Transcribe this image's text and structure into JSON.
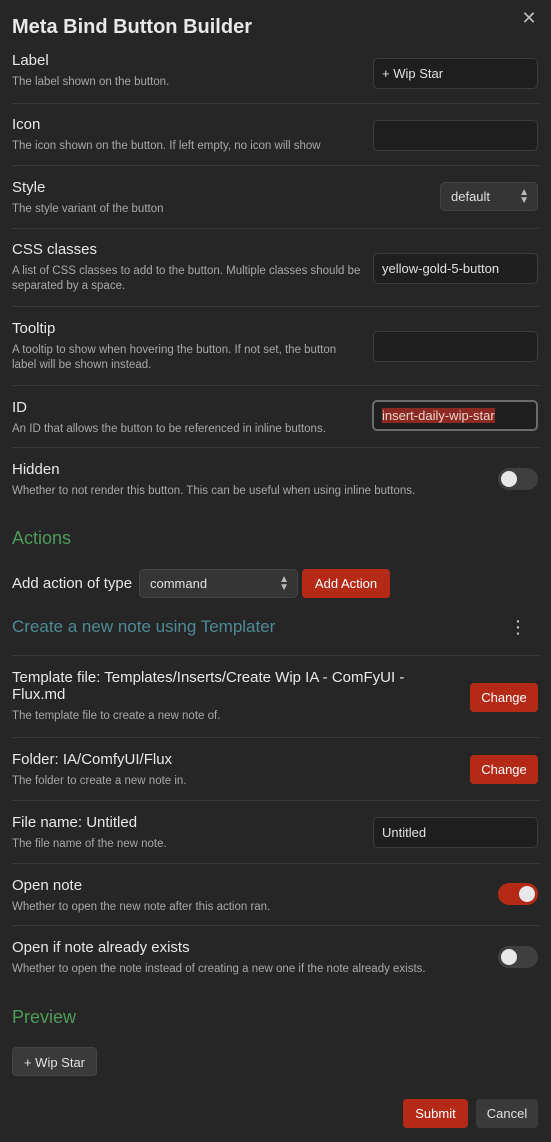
{
  "window": {
    "title": "Meta Bind Button Builder",
    "close_icon": "close-icon"
  },
  "fields": {
    "label": {
      "name": "Label",
      "desc": "The label shown on the button.",
      "value": "+ Wip Star"
    },
    "icon": {
      "name": "Icon",
      "desc": "The icon shown on the button. If left empty, no icon will show",
      "value": ""
    },
    "style": {
      "name": "Style",
      "desc": "The style variant of the button",
      "value": "default"
    },
    "css": {
      "name": "CSS classes",
      "desc": "A list of CSS classes to add to the button. Multiple classes should be separated by a space.",
      "value": "yellow-gold-5-button"
    },
    "tooltip": {
      "name": "Tooltip",
      "desc": "A tooltip to show when hovering the button. If not set, the button label will be shown instead.",
      "value": ""
    },
    "id": {
      "name": "ID",
      "desc": "An ID that allows the button to be referenced in inline buttons.",
      "value": "insert-daily-wip-star"
    },
    "hidden": {
      "name": "Hidden",
      "desc": "Whether to not render this button. This can be useful when using inline buttons.",
      "on": false
    }
  },
  "actions": {
    "heading": "Actions",
    "add_label": "Add action of type",
    "type_value": "command",
    "add_button": "Add Action",
    "action_title": "Create a new note using Templater",
    "template": {
      "name": "Template file: Templates/Inserts/Create Wip IA - ComFyUI - Flux.md",
      "desc": "The template file to create a new note of.",
      "button": "Change"
    },
    "folder": {
      "name": "Folder: IA/ComfyUI/Flux",
      "desc": "The folder to create a new note in.",
      "button": "Change"
    },
    "filename": {
      "name": "File name: Untitled",
      "desc": "The file name of the new note.",
      "value": "Untitled"
    },
    "open_note": {
      "name": "Open note",
      "desc": "Whether to open the new note after this action ran.",
      "on": true
    },
    "open_exists": {
      "name": "Open if note already exists",
      "desc": "Whether to open the note instead of creating a new one if the note already exists.",
      "on": false
    }
  },
  "preview": {
    "heading": "Preview",
    "button": "+ Wip Star"
  },
  "footer": {
    "submit": "Submit",
    "cancel": "Cancel"
  }
}
